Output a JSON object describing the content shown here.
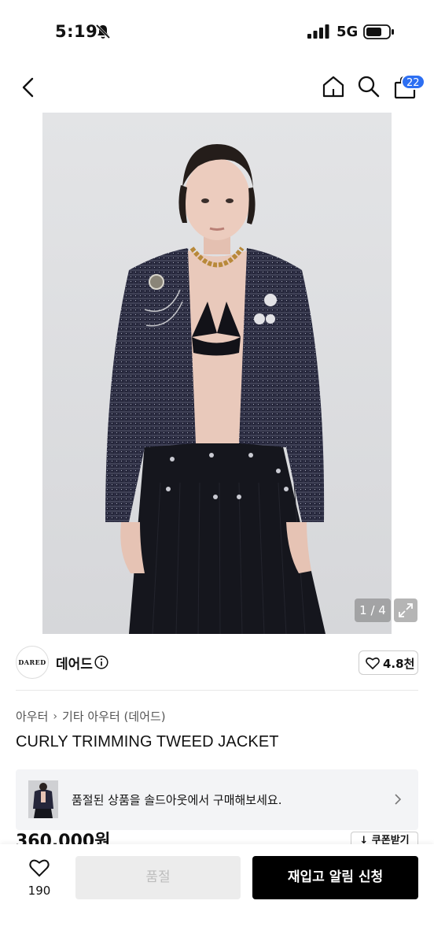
{
  "status_bar": {
    "time": "5:19",
    "network": "5G"
  },
  "header": {
    "cart_count": "22"
  },
  "gallery": {
    "counter": "1 / 4"
  },
  "brand": {
    "logo_text": "DARED",
    "name": "데어드",
    "likes": "4.8천"
  },
  "breadcrumb": {
    "category": "아우터",
    "subcategory": "기타 아우터 (데어드)"
  },
  "product": {
    "title": "CURLY TRIMMING TWEED JACKET",
    "price": "360,000원"
  },
  "soldout_banner": {
    "message": "품절된 상품을 솔드아웃에서 구매해보세요."
  },
  "coupon": {
    "label": "↓ 쿠폰받기"
  },
  "bottom_bar": {
    "wish_count": "190",
    "soldout_label": "품절",
    "restock_label": "재입고 알림 신청"
  },
  "icons": {
    "back": "chevron-left-icon",
    "home": "home-icon",
    "search": "search-icon",
    "bag": "shopping-bag-icon",
    "info": "info-icon",
    "heart": "heart-icon",
    "expand": "expand-icon",
    "chevron": "chevron-right-icon"
  },
  "colors": {
    "badge": "#2d6ff2",
    "primary_button": "#000000",
    "disabled_button": "#ececec"
  }
}
